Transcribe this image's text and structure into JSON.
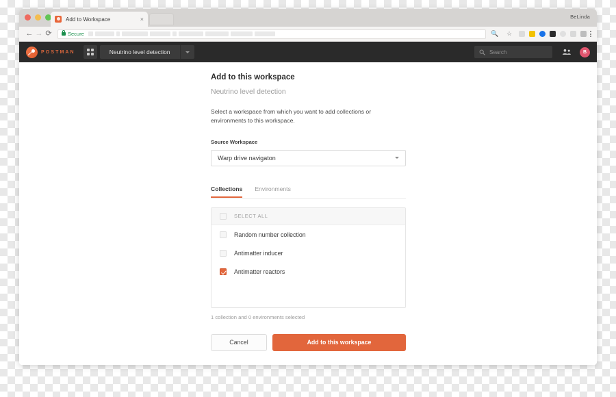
{
  "browser": {
    "tab": {
      "title": "Add to Workspace",
      "favicon": "postman-favicon",
      "close": "×"
    },
    "user_label": "BeLinda",
    "nav": {
      "back": "←",
      "forward": "→",
      "reload": "⟳"
    },
    "omnibox": {
      "secure_label": "Secure",
      "url_value": "",
      "url_redacted": true
    },
    "toolbar_icons": [
      "search-icon",
      "bookmark-star-icon",
      "extension-page-icon",
      "extension-yellow-icon",
      "extension-blue-icon",
      "extension-dark-icon",
      "extension-refresh-icon",
      "extension-chart-icon",
      "extension-screen-icon"
    ],
    "menu_icon": "kebab-menu-icon"
  },
  "postman_header": {
    "wordmark": "POSTMAN",
    "logo_icon": "postman-logo-icon",
    "apps_icon": "grid-apps-icon",
    "workspace_name": "Neutrino level detection",
    "workspace_caret": "chevron-down-icon",
    "search": {
      "placeholder": "Search",
      "icon": "search-icon"
    },
    "team_icon": "team-people-icon",
    "avatar_initial": "B",
    "avatar_color": "#e1566f"
  },
  "dialog": {
    "title": "Add to this workspace",
    "subtitle": "Neutrino level detection",
    "description": "Select a workspace from which you want to add collections or environments to this workspace.",
    "source_workspace": {
      "label": "Source Workspace",
      "value": "Warp drive navigaton",
      "caret": "chevron-down-icon"
    },
    "tabs": [
      {
        "label": "Collections",
        "active": true
      },
      {
        "label": "Environments",
        "active": false
      }
    ],
    "select_all_label": "SELECT ALL",
    "select_all_checked": false,
    "collections": [
      {
        "label": "Random number collection",
        "checked": false
      },
      {
        "label": "Antimatter inducer",
        "checked": false
      },
      {
        "label": "Antimatter reactors",
        "checked": true
      }
    ],
    "status_text": "1 collection and 0 environments selected",
    "buttons": {
      "cancel": "Cancel",
      "primary": "Add to this workspace"
    }
  },
  "colors": {
    "accent": "#e2663c",
    "header_dark": "#2a2a2a",
    "secure_green": "#1a8f4c",
    "avatar": "#e1566f"
  }
}
